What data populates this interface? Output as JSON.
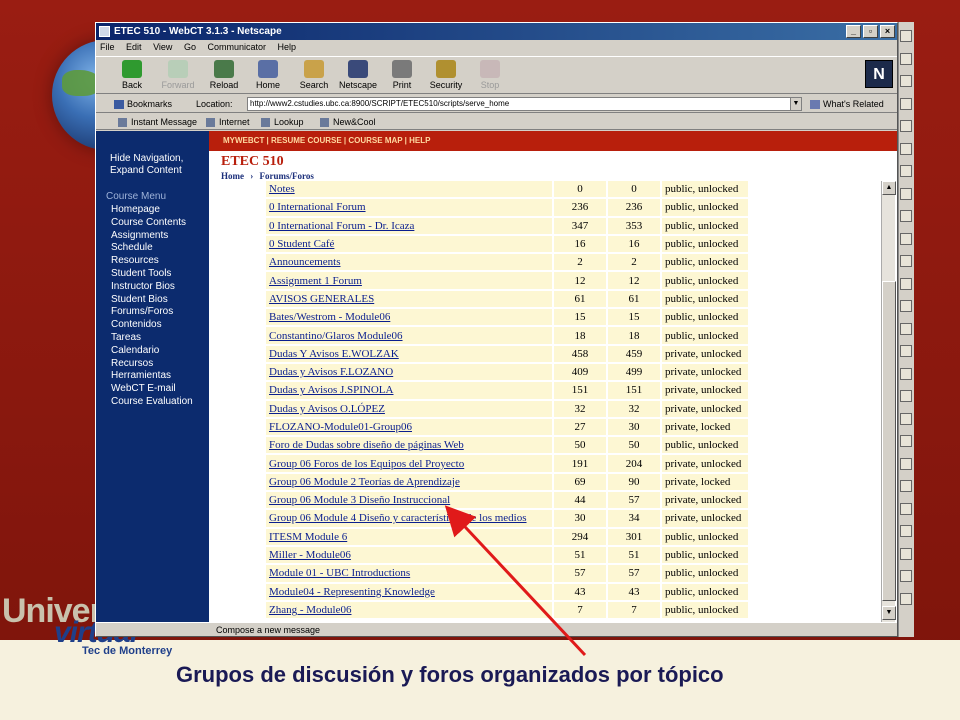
{
  "window": {
    "title": "ETEC 510 - WebCT 3.1.3 - Netscape",
    "minimize": "_",
    "maximize": "▫",
    "close": "×"
  },
  "menubar": [
    "File",
    "Edit",
    "View",
    "Go",
    "Communicator",
    "Help"
  ],
  "toolbar": {
    "buttons": [
      {
        "label": "Back",
        "icon": "back-arrow-icon",
        "color": "#2f9a2f"
      },
      {
        "label": "Forward",
        "icon": "forward-arrow-icon",
        "color": "#9ab89a"
      },
      {
        "label": "Reload",
        "icon": "reload-icon",
        "color": "#4a7a4a"
      },
      {
        "label": "Home",
        "icon": "home-icon",
        "color": "#5a6fa5"
      },
      {
        "label": "Search",
        "icon": "search-icon",
        "color": "#c9a24a"
      },
      {
        "label": "Netscape",
        "icon": "netscape-icon",
        "color": "#3a4a7a"
      },
      {
        "label": "Print",
        "icon": "print-icon",
        "color": "#7a7a7a"
      },
      {
        "label": "Security",
        "icon": "security-lock-icon",
        "color": "#b09030"
      },
      {
        "label": "Stop",
        "icon": "stop-icon",
        "color": "#b0a0a0"
      }
    ],
    "logo": "N"
  },
  "location": {
    "bookmarks_label": "Bookmarks",
    "location_label": "Location:",
    "url": "http://www2.cstudies.ubc.ca:8900/SCRIPT/ETEC510/scripts/serve_home",
    "related_label": "What's Related"
  },
  "personal_toolbar": [
    "Instant Message",
    "Internet",
    "Lookup",
    "New&Cool"
  ],
  "webct": {
    "top_links": "MYWEBCT | RESUME COURSE | COURSE MAP | HELP",
    "course_title": "ETEC 510",
    "breadcrumb_home": "Home",
    "breadcrumb_sep": "›",
    "breadcrumb_current": "Forums/Foros",
    "hide_nav": "Hide Navigation,",
    "expand_content": "Expand Content",
    "course_menu_title": "Course Menu",
    "course_menu": [
      "Homepage",
      "Course Contents",
      "Assignments",
      "Schedule",
      "Resources",
      "Student Tools",
      "Instructor Bios",
      "Student Bios",
      "Forums/Foros",
      "Contenidos",
      "Tareas",
      "Calendario",
      "Recursos",
      "Herramientas",
      "WebCT E-mail",
      "Course Evaluation"
    ]
  },
  "forums": [
    {
      "name": "Notes",
      "unread": "0",
      "total": "0",
      "status": "public, unlocked"
    },
    {
      "name": "0 International Forum",
      "unread": "236",
      "total": "236",
      "status": "public, unlocked"
    },
    {
      "name": "0 International Forum - Dr. Icaza",
      "unread": "347",
      "total": "353",
      "status": "public, unlocked"
    },
    {
      "name": "0 Student Café",
      "unread": "16",
      "total": "16",
      "status": "public, unlocked"
    },
    {
      "name": "Announcements",
      "unread": "2",
      "total": "2",
      "status": "public, unlocked"
    },
    {
      "name": "Assignment 1 Forum",
      "unread": "12",
      "total": "12",
      "status": "public, unlocked"
    },
    {
      "name": "AVISOS GENERALES",
      "unread": "61",
      "total": "61",
      "status": "public, unlocked"
    },
    {
      "name": "Bates/Westrom - Module06",
      "unread": "15",
      "total": "15",
      "status": "public, unlocked"
    },
    {
      "name": "Constantino/Glaros Module06",
      "unread": "18",
      "total": "18",
      "status": "public, unlocked"
    },
    {
      "name": "Dudas Y Avisos E.WOLZAK",
      "unread": "458",
      "total": "459",
      "status": "private, unlocked"
    },
    {
      "name": "Dudas y Avisos F.LOZANO",
      "unread": "409",
      "total": "499",
      "status": "private, unlocked"
    },
    {
      "name": "Dudas y Avisos J.SPINOLA",
      "unread": "151",
      "total": "151",
      "status": "private, unlocked"
    },
    {
      "name": "Dudas y Avisos O.LÓPEZ",
      "unread": "32",
      "total": "32",
      "status": "private, unlocked"
    },
    {
      "name": "FLOZANO-Module01-Group06",
      "unread": "27",
      "total": "30",
      "status": "private, locked"
    },
    {
      "name": "Foro de Dudas sobre diseño de páginas Web",
      "unread": "50",
      "total": "50",
      "status": "public, unlocked"
    },
    {
      "name": "Group 06 Foros de los Equipos del Proyecto",
      "unread": "191",
      "total": "204",
      "status": "private, unlocked"
    },
    {
      "name": "Group 06 Module 2 Teorías de Aprendizaje",
      "unread": "69",
      "total": "90",
      "status": "private, locked"
    },
    {
      "name": "Group 06 Module 3 Diseño Instruccional",
      "unread": "44",
      "total": "57",
      "status": "private, unlocked"
    },
    {
      "name": "Group 06 Module 4 Diseño y características de los medios",
      "unread": "30",
      "total": "34",
      "status": "private, unlocked"
    },
    {
      "name": "ITESM Module 6",
      "unread": "294",
      "total": "301",
      "status": "public, unlocked"
    },
    {
      "name": "Miller - Module06",
      "unread": "51",
      "total": "51",
      "status": "public, unlocked"
    },
    {
      "name": "Module 01 - UBC Introductions",
      "unread": "57",
      "total": "57",
      "status": "public, unlocked"
    },
    {
      "name": "Module04 - Representing Knowledge",
      "unread": "43",
      "total": "43",
      "status": "public, unlocked"
    },
    {
      "name": "Zhang - Module06",
      "unread": "7",
      "total": "7",
      "status": "public, unlocked"
    }
  ],
  "statusbar": {
    "message": "Compose a new message"
  },
  "slide": {
    "caption": "Grupos de discusión y foros organizados por tópico",
    "logo_univ": "Univers",
    "logo_virtual": "virtual",
    "logo_tec": "Tec de Monterrey"
  },
  "colors": {
    "accent_red": "#b81f0c",
    "nav_blue": "#0c2b6e",
    "cell_yellow": "#fdf7d3",
    "link_blue": "#0b1f8f"
  }
}
